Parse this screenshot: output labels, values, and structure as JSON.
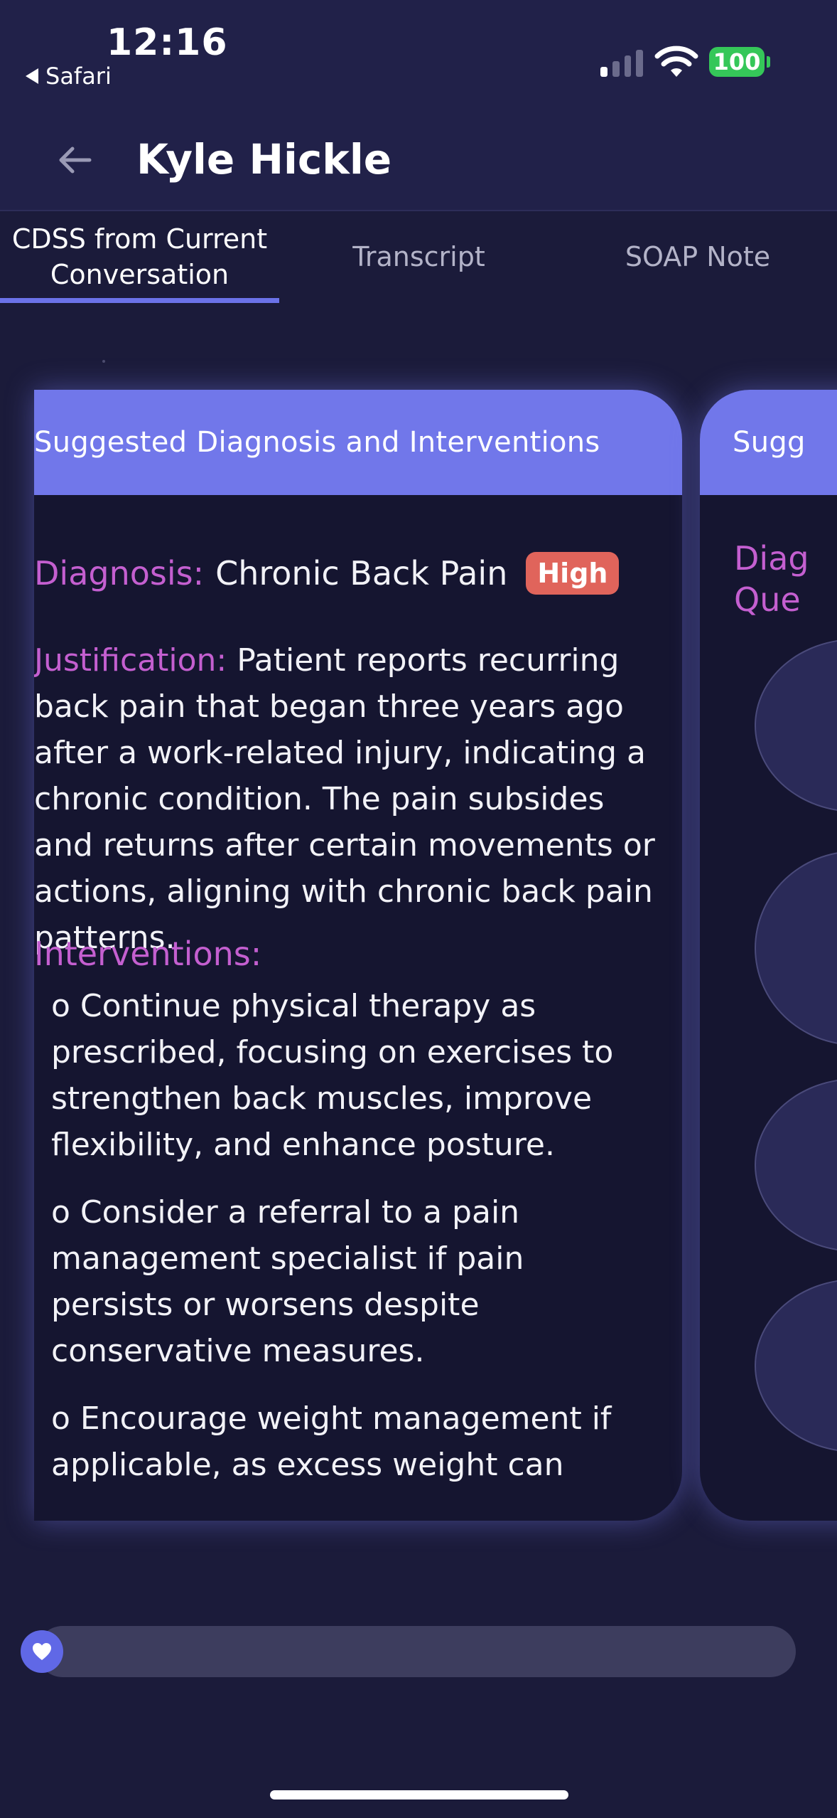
{
  "status_bar": {
    "time": "12:16",
    "back_app": "Safari",
    "battery": "100",
    "icons": [
      "signal-icon",
      "wifi-icon",
      "battery-icon"
    ]
  },
  "header": {
    "title": "Kyle Hickle",
    "back_icon": "arrow-left-icon"
  },
  "tabs": [
    {
      "label": "CDSS from Current Conversation",
      "active": true
    },
    {
      "label": "Transcript",
      "active": false
    },
    {
      "label": "SOAP Note",
      "active": false
    }
  ],
  "cards": {
    "main": {
      "title": "Suggested Diagnosis and Interventions",
      "diagnosis_label": "Diagnosis:",
      "diagnosis": "Chronic Back Pain",
      "badge": "High",
      "justification_label": "Justification:",
      "justification": "Patient reports recurring back pain that began three years ago after a work-related injury, indicating a chronic condition. The pain subsides and returns after certain movements or actions, aligning with chronic back pain patterns.",
      "interventions_label": "Interventions:",
      "interventions": [
        "o Continue physical therapy as prescribed, focusing on exercises to strengthen back muscles, improve flexibility, and enhance posture.",
        "o Consider a referral to a pain management specialist if pain persists or worsens despite conservative measures.",
        "o Encourage weight management if applicable, as excess weight can"
      ]
    },
    "side": {
      "title": "Sugg",
      "label": "Diag Que"
    }
  },
  "colors": {
    "background": "#1b1b3a",
    "header": "#212149",
    "accent": "#7177ea",
    "label": "#c45fd0",
    "badge_high": "#e0645b"
  },
  "progress": 0
}
